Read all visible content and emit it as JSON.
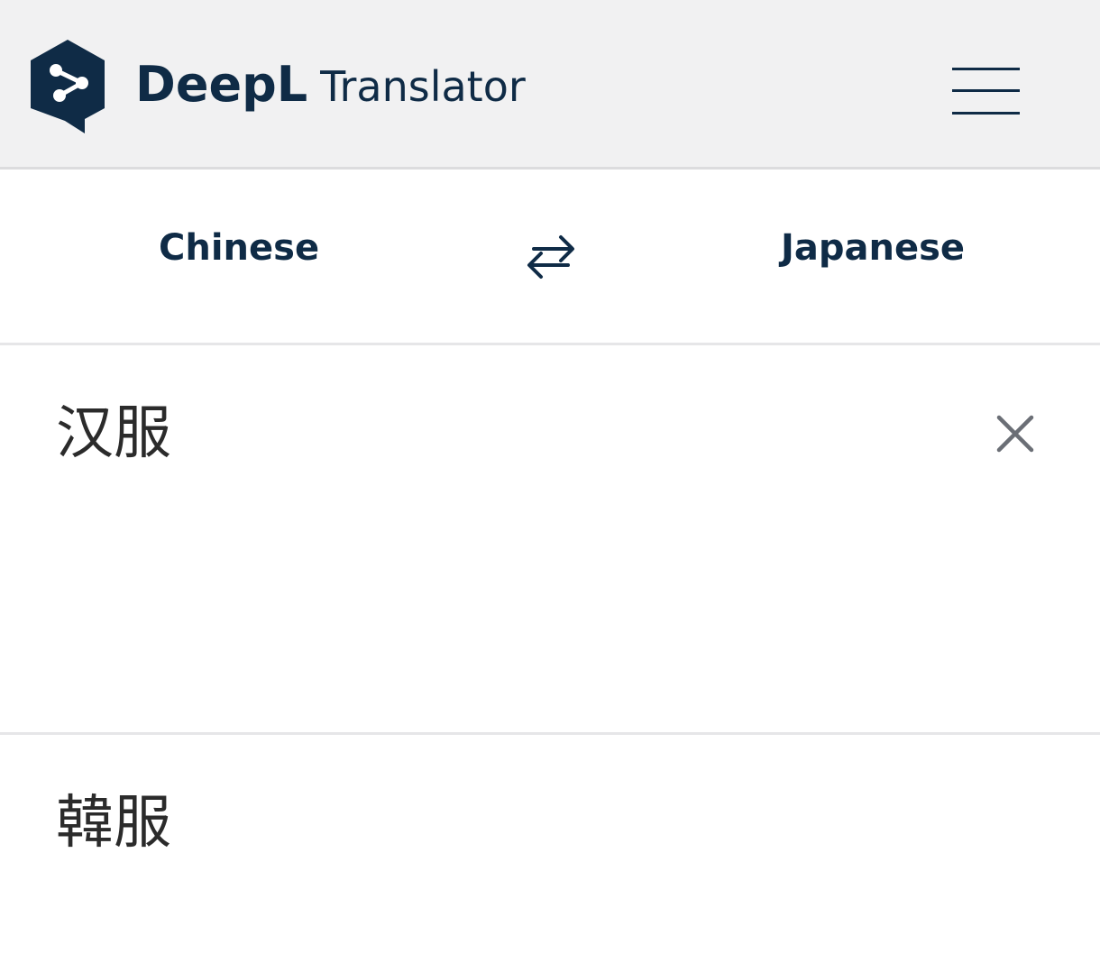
{
  "header": {
    "brand_name": "DeepL",
    "brand_sub": "Translator",
    "logo_icon": "deepl-logo-icon",
    "menu_icon": "hamburger-menu-icon"
  },
  "languages": {
    "source": "Chinese",
    "target": "Japanese",
    "swap_icon": "swap-arrows-icon"
  },
  "source": {
    "text": "汉服",
    "clear_icon": "close-icon"
  },
  "target": {
    "text": "韓服"
  },
  "colors": {
    "brand": "#0f2b46",
    "header_bg": "#f1f1f2",
    "divider": "#e6e6e8",
    "text": "#2b2b2b",
    "clear_icon": "#6b6f76"
  }
}
